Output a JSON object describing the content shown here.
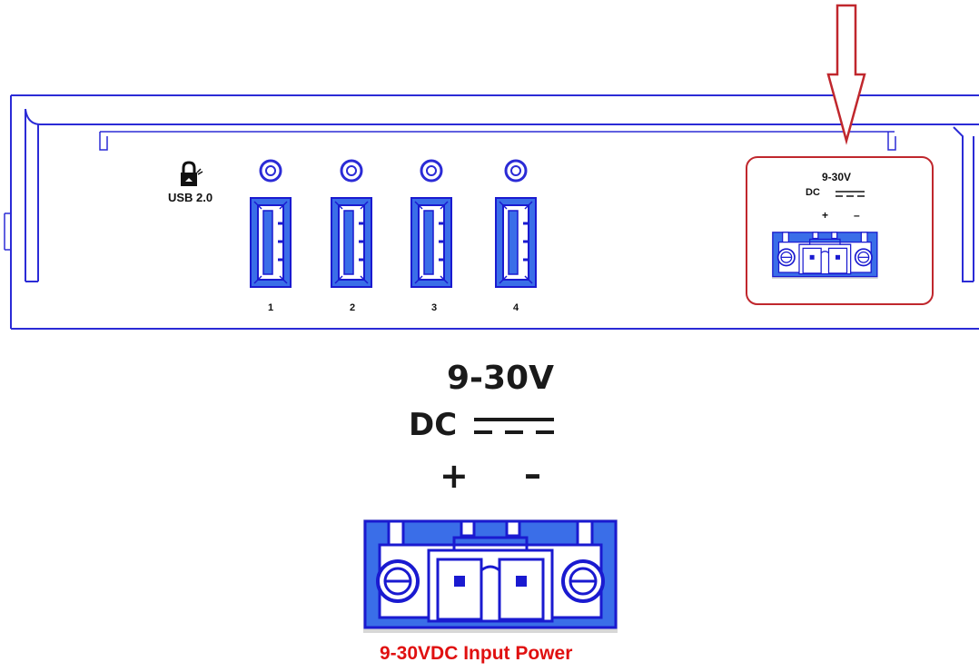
{
  "device": {
    "usb_label": "USB 2.0",
    "ports": [
      "1",
      "2",
      "3",
      "4"
    ]
  },
  "power_small": {
    "voltage": "9-30V",
    "dc": "DC",
    "plus": "+",
    "minus": "–"
  },
  "power_large": {
    "voltage": "9-30V",
    "dc": "DC",
    "plus": "+",
    "minus": "–"
  },
  "caption": "9-30VDC Input Power",
  "colors": {
    "outline": "#2b2bd6",
    "highlight": "#c0272d",
    "caption": "#e01010",
    "connector_fill": "#3a6ee8",
    "connector_line": "#1a1ad0"
  },
  "icons": [
    "usb-lock-icon",
    "down-arrow-icon",
    "dc-symbol-icon"
  ]
}
